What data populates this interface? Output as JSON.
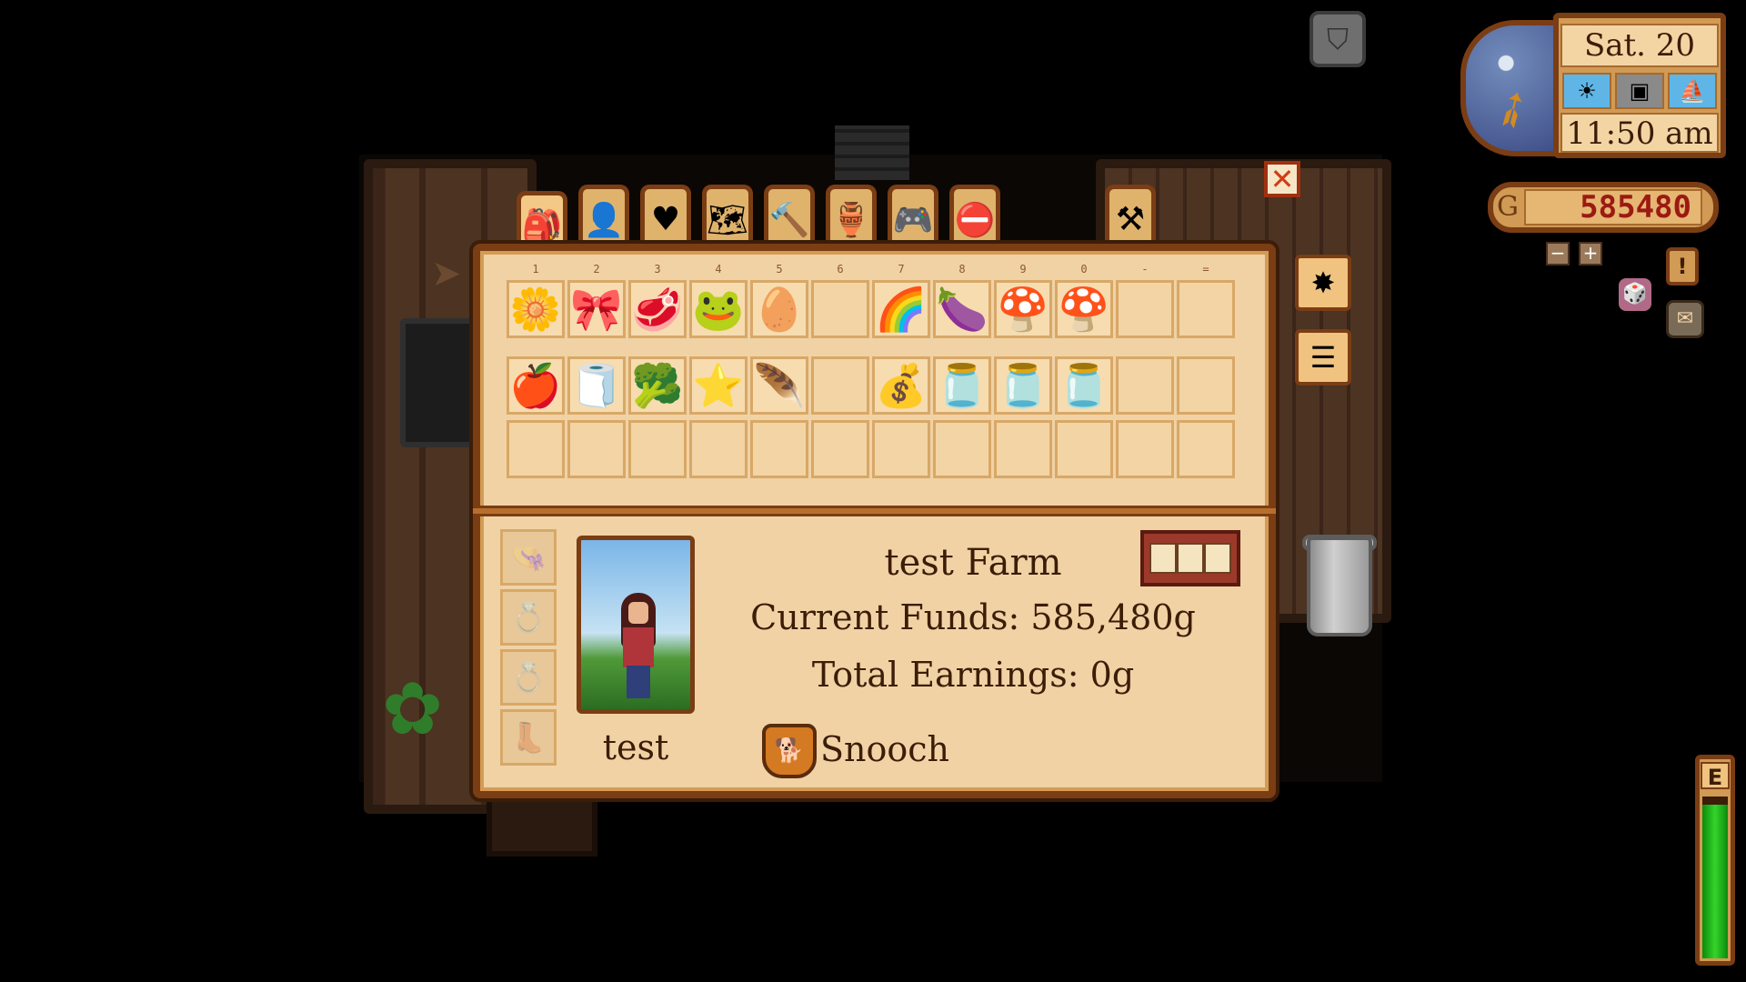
{
  "hud": {
    "date": "Sat. 20",
    "time": "11:50 am",
    "money_counter": "585480",
    "money_prefix": "G",
    "energy_label": "E",
    "energy_level": 0.95,
    "weather_icons": [
      "sun-icon",
      "festival-icon",
      "boat-icon"
    ]
  },
  "tabs": [
    {
      "name": "inventory",
      "icon": "backpack-icon",
      "glyph": "🎒",
      "active": true
    },
    {
      "name": "skills",
      "icon": "player-face-icon",
      "glyph": "👤",
      "active": false
    },
    {
      "name": "social",
      "icon": "heart-icon",
      "glyph": "♥",
      "active": false
    },
    {
      "name": "map",
      "icon": "map-icon",
      "glyph": "🗺",
      "active": false
    },
    {
      "name": "crafting",
      "icon": "hammer-icon",
      "glyph": "🔨",
      "active": false
    },
    {
      "name": "collections",
      "icon": "vase-icon",
      "glyph": "🏺",
      "active": false
    },
    {
      "name": "options",
      "icon": "controller-icon",
      "glyph": "🎮",
      "active": false
    },
    {
      "name": "exit",
      "icon": "exit-icon",
      "glyph": "⛔",
      "active": false
    }
  ],
  "right_tab": {
    "icon": "hammer-pickaxe-icon",
    "glyph": "⚒"
  },
  "slot_numbers": [
    "1",
    "2",
    "3",
    "4",
    "5",
    "6",
    "7",
    "8",
    "9",
    "0",
    "-",
    "="
  ],
  "inventory": {
    "row1": [
      {
        "icon": "mixed-seeds-icon",
        "glyph": "🌼"
      },
      {
        "icon": "purple-cloth-icon",
        "glyph": "🎀"
      },
      {
        "icon": "red-slime-icon",
        "glyph": "🥩"
      },
      {
        "icon": "frog-icon",
        "glyph": "🐸"
      },
      {
        "icon": "golden-egg-icon",
        "glyph": "🥚"
      },
      {
        "icon": "",
        "glyph": ""
      },
      {
        "icon": "rainbow-heart-icon",
        "glyph": "🌈"
      },
      {
        "icon": "eggplant-sprout-icon",
        "glyph": "🍆"
      },
      {
        "icon": "red-mushroom-icon",
        "glyph": "🍄"
      },
      {
        "icon": "green-mushroom-icon",
        "glyph": "🍄"
      },
      {
        "icon": "",
        "glyph": ""
      },
      {
        "icon": "",
        "glyph": ""
      }
    ],
    "row2": [
      {
        "icon": "apple-icon",
        "glyph": "🍎"
      },
      {
        "icon": "bandage-icon",
        "glyph": "🧻"
      },
      {
        "icon": "cauliflower-icon",
        "glyph": "🥦"
      },
      {
        "icon": "stardrop-star-icon",
        "glyph": "⭐"
      },
      {
        "icon": "feather-icon",
        "glyph": "🪶"
      },
      {
        "icon": "",
        "glyph": ""
      },
      {
        "icon": "seed-bag-icon",
        "glyph": "💰"
      },
      {
        "icon": "eggplant-jar-icon",
        "glyph": "🫙"
      },
      {
        "icon": "red-jar-icon",
        "glyph": "🫙"
      },
      {
        "icon": "green-jar-icon",
        "glyph": "🫙"
      },
      {
        "icon": "",
        "glyph": ""
      },
      {
        "icon": "",
        "glyph": ""
      }
    ],
    "row3": [
      {
        "icon": "",
        "glyph": ""
      },
      {
        "icon": "",
        "glyph": ""
      },
      {
        "icon": "",
        "glyph": ""
      },
      {
        "icon": "",
        "glyph": ""
      },
      {
        "icon": "",
        "glyph": ""
      },
      {
        "icon": "",
        "glyph": ""
      },
      {
        "icon": "",
        "glyph": ""
      },
      {
        "icon": "",
        "glyph": ""
      },
      {
        "icon": "",
        "glyph": ""
      },
      {
        "icon": "",
        "glyph": ""
      },
      {
        "icon": "",
        "glyph": ""
      },
      {
        "icon": "",
        "glyph": ""
      }
    ]
  },
  "equipment_slots": [
    {
      "icon": "hat-slot-icon",
      "glyph": "👒"
    },
    {
      "icon": "ring-slot-icon",
      "glyph": "💍"
    },
    {
      "icon": "ring-slot-icon",
      "glyph": "💍"
    },
    {
      "icon": "boots-slot-icon",
      "glyph": "👢"
    }
  ],
  "player": {
    "name": "test",
    "farm_name": "test Farm",
    "current_funds": "Current Funds: 585,480g",
    "total_earnings": "Total Earnings: 0g",
    "pet_name": "Snooch",
    "pet_icon": "dog-icon"
  },
  "buttons": {
    "close": "✕",
    "organize_icon": "organize-icon",
    "trash_list_icon": "list-icon",
    "shield_icon": "shield-icon",
    "journal": "!",
    "quest": "✉",
    "luck": "🎲",
    "zoom_out": "−",
    "zoom_in": "+"
  }
}
